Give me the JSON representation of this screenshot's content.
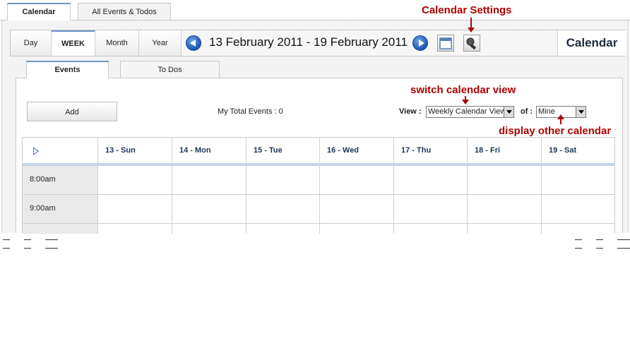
{
  "top_tabs": [
    "Calendar",
    "All Events & Todos"
  ],
  "toolbar": {
    "views": [
      "Day",
      "WEEK",
      "Month",
      "Year"
    ],
    "date_range": "13 February 2011 - 19 February 2011",
    "title": "Calendar"
  },
  "annotations": {
    "calendar_settings": "Calendar Settings",
    "switch_view": "switch calendar view",
    "display_other": "display other calendar"
  },
  "inner_tabs": [
    "Events",
    "To Dos"
  ],
  "controls": {
    "add_label": "Add",
    "total_events": "My Total Events : 0",
    "view_label": "View :",
    "view_value": "Weekly Calendar View",
    "of_label": "of :",
    "of_value": "Mine"
  },
  "grid": {
    "days": [
      "13 - Sun",
      "14 - Mon",
      "15 - Tue",
      "16 - Wed",
      "17 - Thu",
      "18 - Fri",
      "19 - Sat"
    ],
    "times": [
      "8:00am",
      "9:00am"
    ]
  },
  "colors": {
    "accent": "#6e93c8",
    "annotation": "#b00000",
    "nav_button": "#1a56b4"
  }
}
